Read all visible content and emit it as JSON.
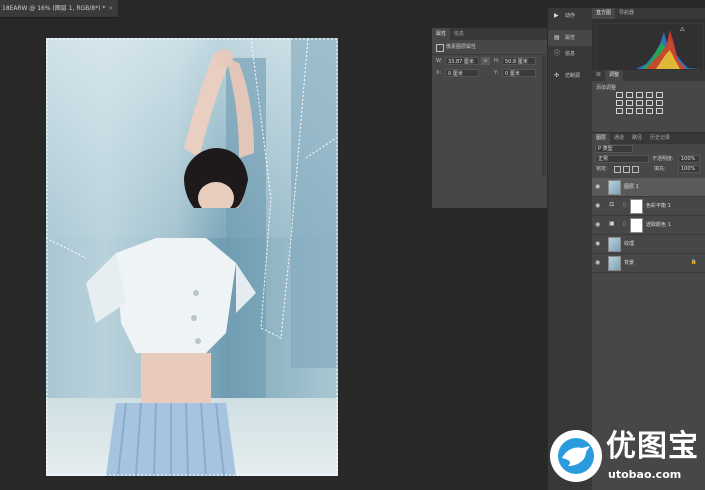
{
  "document": {
    "tab_title": "18EARW @ 16% (图层 1, RGB/8*) *",
    "close_glyph": "×"
  },
  "properties_panel": {
    "tabs": [
      "属性",
      "信息"
    ],
    "active_tab": "属性",
    "section_title": "像素图层属性",
    "width_label": "W:",
    "width_value": "33.87 厘米",
    "height_label": "H:",
    "height_value": "50.8 厘米",
    "link_glyph": "∞",
    "x_label": "X:",
    "x_value": "0 厘米",
    "y_label": "Y:",
    "y_value": "0 厘米"
  },
  "icon_column": {
    "items": [
      {
        "icon": "play-icon",
        "glyph": "▶",
        "label": "动作"
      },
      {
        "icon": "properties-icon",
        "glyph": "▤",
        "label": "属性"
      },
      {
        "icon": "info-icon",
        "glyph": "ⓘ",
        "label": "信息"
      },
      {
        "icon": "source-icon",
        "glyph": "✣",
        "label": "仿制源"
      }
    ],
    "active": "属性"
  },
  "histogram_panel": {
    "tabs": [
      "直方图",
      "导航器"
    ],
    "active_tab": "直方图",
    "warning_glyph": "⚠"
  },
  "adjustments_panel": {
    "tabs": [
      "库",
      "调整"
    ],
    "active_tab": "调整",
    "label": "添加调整"
  },
  "layers_panel": {
    "tabs": [
      "图层",
      "通道",
      "路径",
      "历史记录"
    ],
    "active_tab": "图层",
    "kind_filter": "P 类型",
    "blend_mode": "正常",
    "opacity_label": "不透明度:",
    "opacity_value": "100%",
    "lock_label": "锁定:",
    "fill_label": "填充:",
    "fill_value": "100%",
    "layers": [
      {
        "name": "图层 1",
        "type": "pixel",
        "selected": true
      },
      {
        "name": "色彩平衡 1",
        "type": "adjustment",
        "selected": false
      },
      {
        "name": "选取颜色 1",
        "type": "adjustment",
        "selected": false
      },
      {
        "name": "纹理",
        "type": "pixel",
        "selected": false
      },
      {
        "name": "背景",
        "type": "background",
        "selected": false
      }
    ],
    "eye_glyph": "◉",
    "lock_glyph": "🔒"
  },
  "watermark": {
    "brand": "优图宝",
    "url": "utobao.com"
  }
}
